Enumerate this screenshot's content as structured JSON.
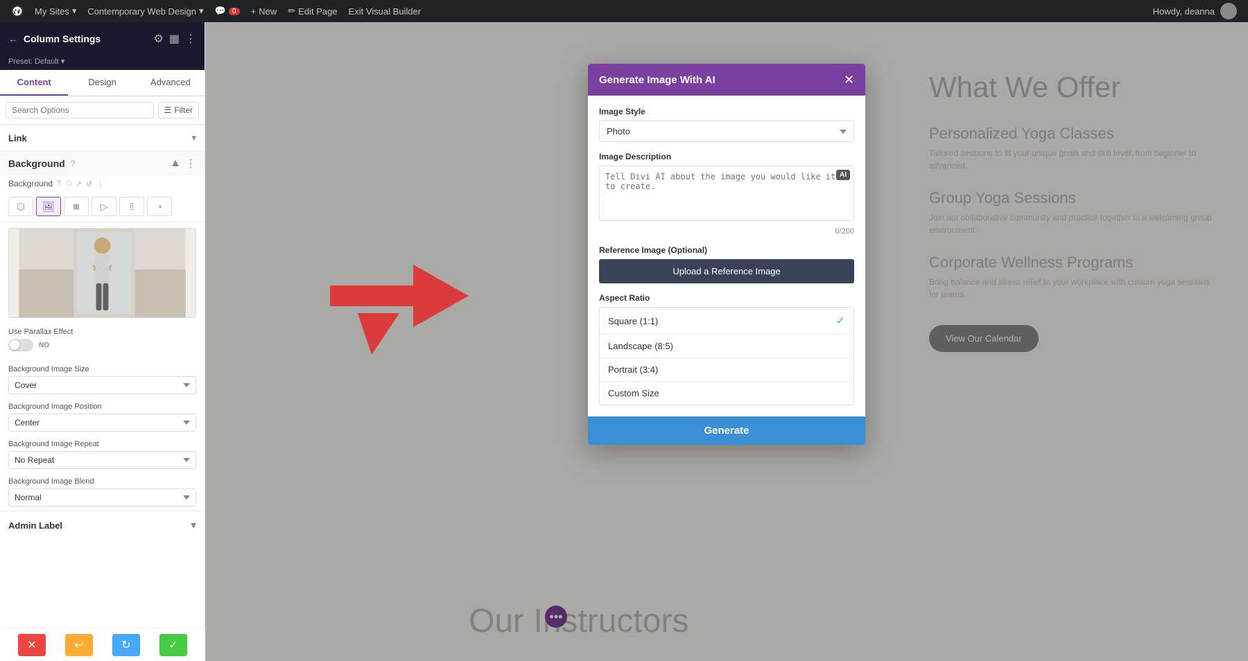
{
  "admin_bar": {
    "wp_logo": "W",
    "my_sites": "My Sites",
    "site_name": "Contemporary Web Design",
    "comments": "0",
    "new": "New",
    "edit_page": "Edit Page",
    "exit_builder": "Exit Visual Builder",
    "user": "Howdy, deanna"
  },
  "sidebar": {
    "title": "Column Settings",
    "preset": "Preset: Default",
    "tabs": [
      "Content",
      "Design",
      "Advanced"
    ],
    "active_tab": "Content",
    "search_placeholder": "Search Options",
    "filter_label": "Filter",
    "link_section": "Link",
    "background_section": "Background",
    "background_label": "Background",
    "parallax_label": "Use Parallax Effect",
    "parallax_value": "NO",
    "bg_size_label": "Background Image Size",
    "bg_size_value": "Cover",
    "bg_position_label": "Background Image Position",
    "bg_position_value": "Center",
    "bg_repeat_label": "Background Image Repeat",
    "bg_repeat_value": "No Repeat",
    "bg_blend_label": "Background Image Blend",
    "bg_blend_value": "Normal",
    "admin_label_section": "Admin Label",
    "toolbar": {
      "cancel": "✕",
      "undo": "↩",
      "redo": "↻",
      "save": "✓"
    }
  },
  "modal": {
    "title": "Generate Image With AI",
    "image_style_label": "Image Style",
    "image_style_value": "Photo",
    "image_description_label": "Image Description",
    "image_description_placeholder": "Tell Divi AI about the image you would like it to create.",
    "ai_badge": "AI",
    "char_count": "0/200",
    "reference_image_label": "Reference Image (Optional)",
    "upload_btn": "Upload a Reference Image",
    "aspect_ratio_label": "Aspect Ratio",
    "aspect_options": [
      {
        "label": "Square (1:1)",
        "selected": true
      },
      {
        "label": "Landscape (8:5)",
        "selected": false
      },
      {
        "label": "Portrait (3:4)",
        "selected": false
      },
      {
        "label": "Custom Size",
        "selected": false
      }
    ],
    "generate_btn": "Generate"
  },
  "website": {
    "offer_title": "What We Offer",
    "items": [
      {
        "title": "Personalized Yoga Classes",
        "desc": "Tailored sessions to fit your unique goals and skill level, from beginner to advanced."
      },
      {
        "title": "Group Yoga Sessions",
        "desc": "Join our collaborative community and practice together in a welcoming group environment."
      },
      {
        "title": "Corporate Wellness Programs",
        "desc": "Bring balance and stress relief to your workplace with custom yoga sessions for teams."
      }
    ],
    "calendar_btn": "View Our Calendar",
    "instructors_title": "Our Instructors"
  }
}
